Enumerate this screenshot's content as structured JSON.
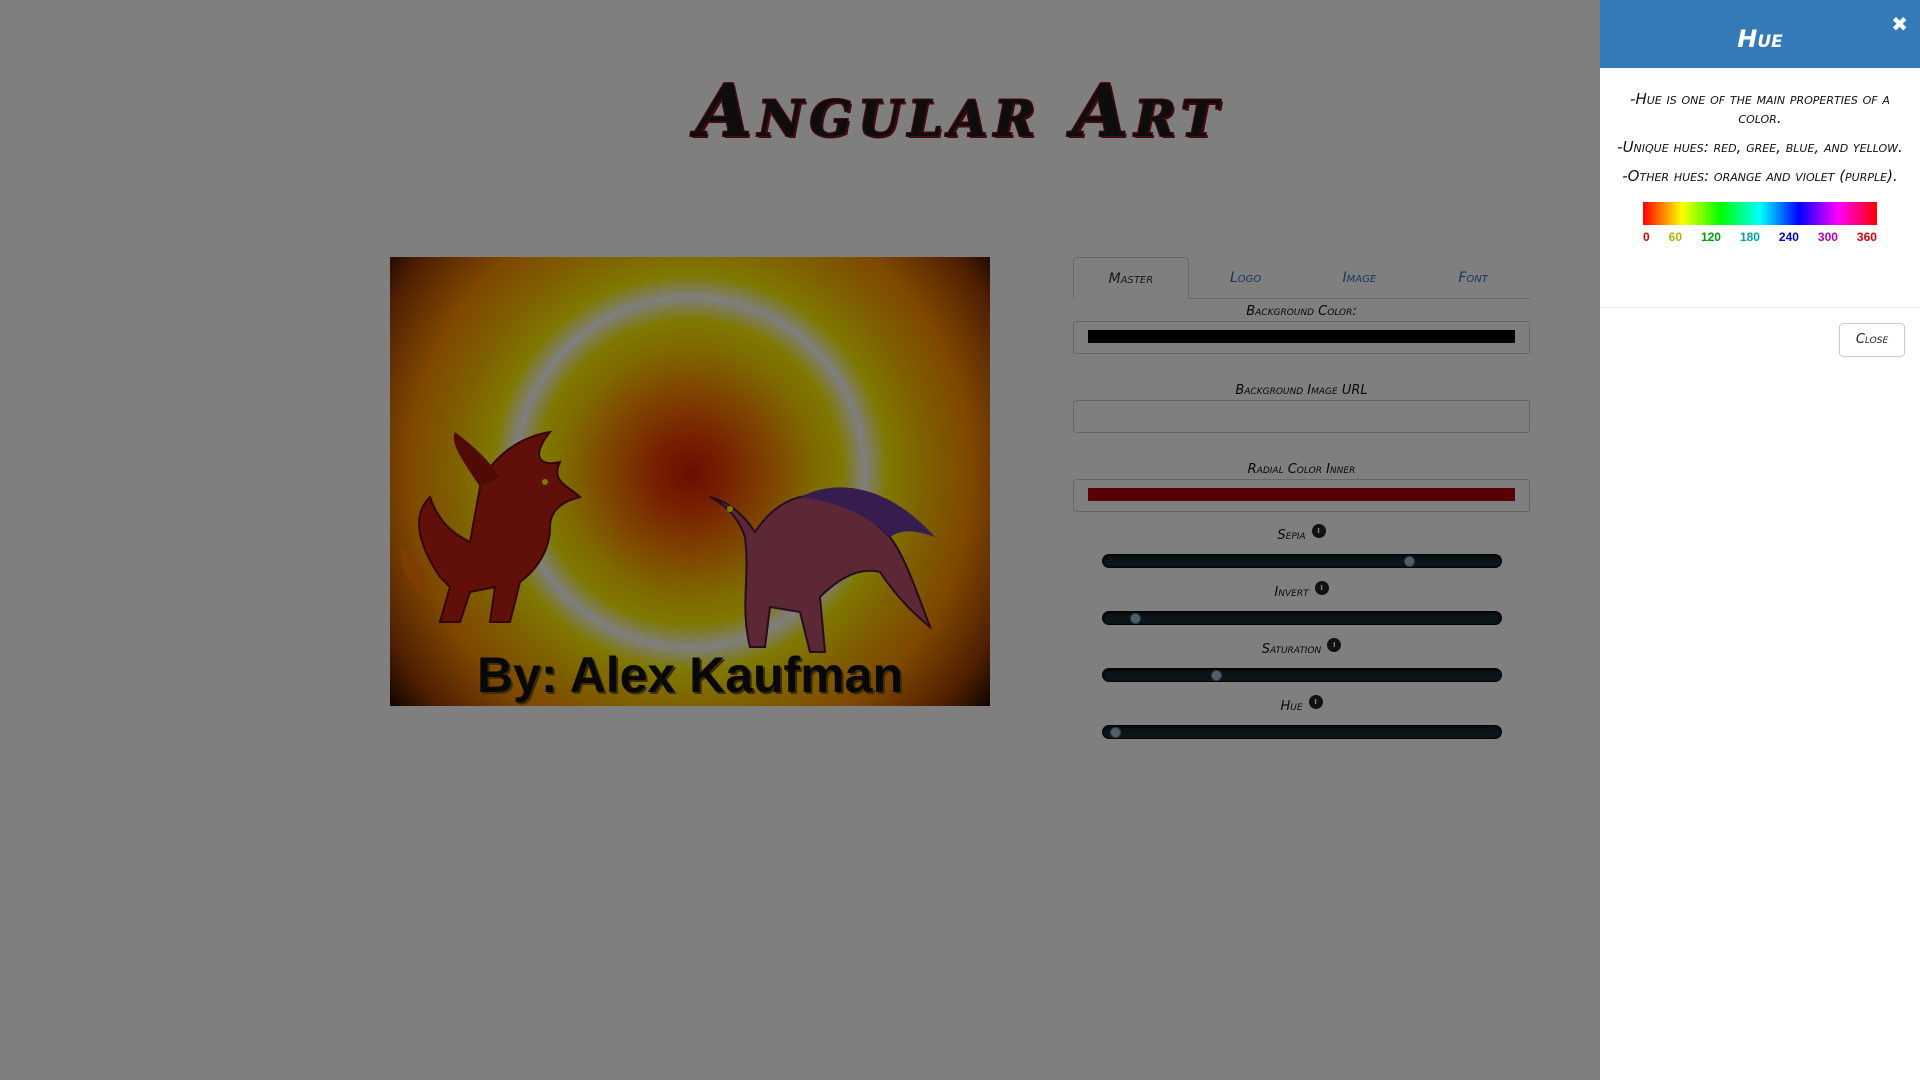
{
  "page": {
    "title": "Angular Art"
  },
  "artwork": {
    "caption": "By: Alex Kaufman"
  },
  "tabs": [
    {
      "label": "Master",
      "active": true
    },
    {
      "label": "Logo",
      "active": false
    },
    {
      "label": "Image",
      "active": false
    },
    {
      "label": "Font",
      "active": false
    }
  ],
  "fields": {
    "background_color": {
      "label": "Background Color:",
      "value_color": "#000000"
    },
    "background_image_url": {
      "label": "Background Image URL",
      "value": ""
    },
    "radial_color_inner": {
      "label": "Radial Color Inner",
      "value_color": "#b0000b"
    }
  },
  "sliders": [
    {
      "label": "Sepia",
      "value": 0.78
    },
    {
      "label": "Invert",
      "value": 0.07
    },
    {
      "label": "Saturation",
      "value": 0.28
    },
    {
      "label": "Hue",
      "value": 0.02
    }
  ],
  "panel": {
    "title": "Hue",
    "close_icon": "close-icon",
    "lines": [
      "-Hue is one of the main properties of a color.",
      "-Unique hues: red, gree, blue, and yellow.",
      "-Other hues: orange and violet (purple)."
    ],
    "hue_ticks": [
      {
        "label": "0",
        "color": "#d40000"
      },
      {
        "label": "60",
        "color": "#b8b000"
      },
      {
        "label": "120",
        "color": "#00a000"
      },
      {
        "label": "180",
        "color": "#00a0a0"
      },
      {
        "label": "240",
        "color": "#0000c8"
      },
      {
        "label": "300",
        "color": "#b000b0"
      },
      {
        "label": "360",
        "color": "#d40000"
      }
    ],
    "close_label": "Close"
  }
}
